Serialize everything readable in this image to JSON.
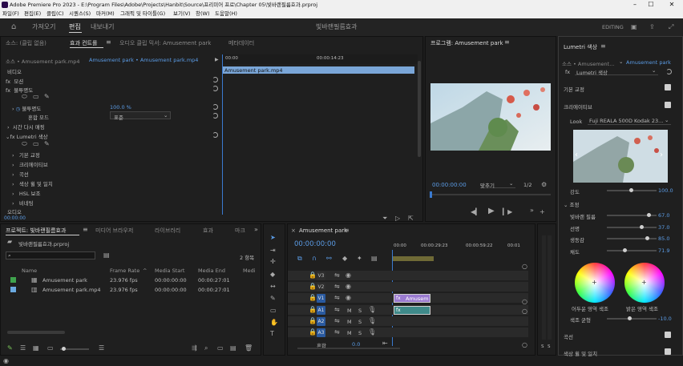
{
  "title": "Adobe Premiere Pro 2023 - E:\\Program Files\\Adobe\\Projects\\Hanbit\\Source\\프리미어 프로\\Chapter 05\\빛바랜필름효과.prproj",
  "menu": [
    "파일(F)",
    "편집(E)",
    "클립(C)",
    "시퀀스(S)",
    "마커(M)",
    "그래픽 및 타이틀(G)",
    "보기(V)",
    "창(W)",
    "도움말(H)"
  ],
  "workspaces": {
    "home": "홈",
    "import": "가져오기",
    "edit": "편집",
    "export": "내보내기",
    "project_name": "빛바랜필름효과",
    "mode": "EDITING"
  },
  "top_left": {
    "tabs": [
      "소스: (클립 없음)",
      "효과 컨트롤",
      "오디오 클립 믹서: Amusement park",
      "메타데이터"
    ],
    "source_clip": "소스 • Amusement park.mp4",
    "seq_clip": "Amusement park • Amusement park.mp4",
    "ruler_start": "00:00",
    "ruler_mid": "00:00:14:23",
    "clip_bar": "Amusement park.mp4",
    "video_label": "비디오",
    "motion": "모션",
    "opacity": "불투명도",
    "opacity_label": "불투명도",
    "opacity_value": "100.0 %",
    "blend_label": "혼합 모드",
    "blend_value": "표준",
    "time_remap": "시간 다시 매핑",
    "lumetri": "Lumetri 색상",
    "basic": "기본 교정",
    "creative": "크리에이티브",
    "curves": "곡선",
    "wheels": "색상 휠 및 일치",
    "hsl": "HSL 보조",
    "vignette": "비네팅",
    "audio_label": "오디오",
    "timecode": "00:00:00"
  },
  "program": {
    "title": "프로그램: Amusement park",
    "timecode": "00:00:00:00",
    "fit": "맞추기",
    "quality": "1/2"
  },
  "project": {
    "tabs": [
      "프로젝트: 빛바랜필름효과",
      "미디어 브라우저",
      "라이브러리",
      "효과",
      "마크"
    ],
    "file": "빛바랜필름효과.prproj",
    "count": "2 항목",
    "columns": [
      "Name",
      "Frame Rate",
      "Media Start",
      "Media End",
      "Medi"
    ],
    "items": [
      {
        "name": "Amusement park",
        "fps": "23.976 fps",
        "start": "00:00:00:00",
        "end": "00:00:27:01",
        "color": "#3fa34d"
      },
      {
        "name": "Amusement park.mp4",
        "fps": "23.976 fps",
        "start": "00:00:00:00",
        "end": "00:00:27:01",
        "color": "#6aa9e0"
      }
    ]
  },
  "timeline": {
    "title": "Amusement park",
    "timecode": "00:00:00:00",
    "ruler": [
      "00:00",
      "00:00:29:23",
      "00:00:59:22",
      "00:01"
    ],
    "video_tracks": [
      "V3",
      "V2",
      "V1"
    ],
    "audio_tracks": [
      "A1",
      "A2",
      "A3"
    ],
    "clip_label": "Amusem",
    "master": "혼합",
    "master_value": "0.0",
    "meter_labels": [
      "S",
      "S"
    ]
  },
  "lumetri": {
    "title": "Lumetri 색상",
    "source": "소스 • Amusement...",
    "seq": "Amusement park",
    "fx_name": "Lumetri 색상",
    "basic": "기본 교정",
    "creative": "크리에이티브",
    "look_label": "Look",
    "look_value": "Fuji REALA 500D Kodak 23...",
    "intensity_label": "강도",
    "intensity_value": "100.0",
    "adjust": "조정",
    "faded_label": "빛바랜 필름",
    "faded_value": "67.0",
    "sharpen_label": "선명",
    "sharpen_value": "37.0",
    "vibrance_label": "생동감",
    "vibrance_value": "85.0",
    "saturation_label": "채도",
    "saturation_value": "71.9",
    "shadow_tint": "어두운 영역 색조",
    "highlight_tint": "밝은 영역 색조",
    "tint_balance": "색조 균형",
    "tint_balance_value": "-10.0",
    "curves": "곡선",
    "wheels": "색상 휠 및 일치",
    "values": {
      "intensity": 100,
      "faded": 67,
      "sharpen": 37,
      "vibrance": 85,
      "saturation": 71.9
    }
  }
}
